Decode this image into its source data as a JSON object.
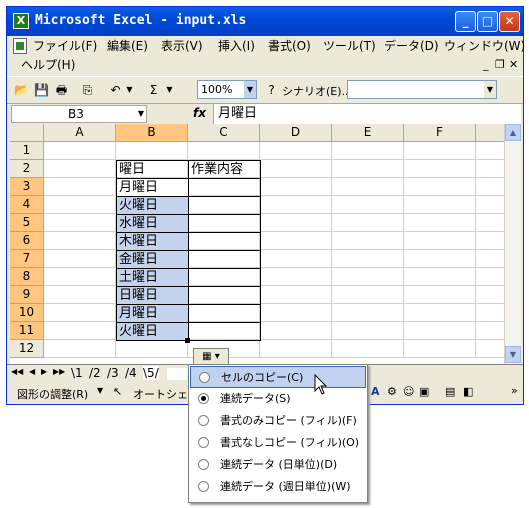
{
  "window": {
    "title": "Microsoft Excel - input.xls"
  },
  "menu": [
    {
      "label": "ファイル(F)"
    },
    {
      "label": "編集(E)"
    },
    {
      "label": "表示(V)"
    },
    {
      "label": "挿入(I)"
    },
    {
      "label": "書式(O)"
    },
    {
      "label": "ツール(T)"
    },
    {
      "label": "データ(D)"
    },
    {
      "label": "ウィンドウ(W)"
    },
    {
      "label": "ヘルプ(H)"
    }
  ],
  "toolbar": {
    "zoom": "100%",
    "scenario_label": "シナリオ(E)...",
    "sigma": "Σ"
  },
  "formula": {
    "cell_ref": "B3",
    "fx": "fx",
    "content": "月曜日"
  },
  "columns": [
    "A",
    "B",
    "C",
    "D",
    "E",
    "F"
  ],
  "rows": [
    "1",
    "2",
    "3",
    "4",
    "5",
    "6",
    "7",
    "8",
    "9",
    "10",
    "11",
    "12"
  ],
  "cells": {
    "B2": "曜日",
    "C2": "作業内容",
    "B3": "月曜日",
    "B4": "火曜日",
    "B5": "水曜日",
    "B6": "木曜日",
    "B7": "金曜日",
    "B8": "土曜日",
    "B9": "日曜日",
    "B10": "月曜日",
    "B11": "火曜日"
  },
  "sheet_tabs": [
    "1",
    "2",
    "3",
    "4",
    "5"
  ],
  "drawbar": {
    "adjust": "図形の調整(R)",
    "autoshape": "オートシェイ"
  },
  "autofill_menu": [
    {
      "label": "セルのコピー(C)",
      "selected": false,
      "highlighted": true
    },
    {
      "label": "連続データ(S)",
      "selected": true,
      "highlighted": false
    },
    {
      "label": "書式のみコピー (フィル)(F)",
      "selected": false,
      "highlighted": false
    },
    {
      "label": "書式なしコピー (フィル)(O)",
      "selected": false,
      "highlighted": false
    },
    {
      "label": "連続データ (日単位)(D)",
      "selected": false,
      "highlighted": false
    },
    {
      "label": "連続データ (週日単位)(W)",
      "selected": false,
      "highlighted": false
    }
  ]
}
